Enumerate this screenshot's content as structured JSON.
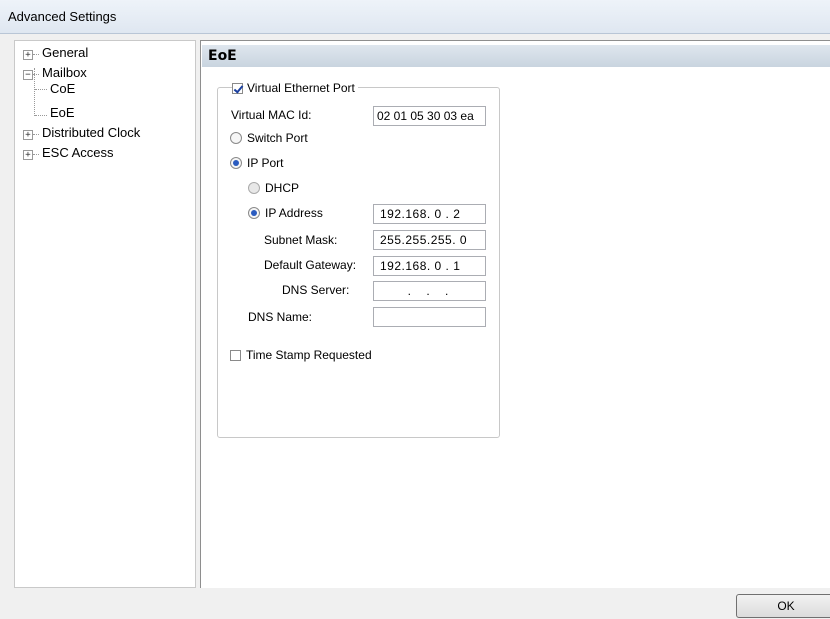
{
  "window": {
    "title": "Advanced Settings"
  },
  "tree": {
    "items": [
      {
        "label": "General",
        "expander": "+"
      },
      {
        "label": "Mailbox",
        "expander": "−"
      },
      {
        "label": "CoE"
      },
      {
        "label": "EoE"
      },
      {
        "label": "Distributed Clock",
        "expander": "+"
      },
      {
        "label": "ESC Access",
        "expander": "+"
      }
    ]
  },
  "panel": {
    "header": "EoE",
    "virtual_ethernet_port": {
      "label": "Virtual Ethernet Port",
      "checked": true
    },
    "mac": {
      "label": "Virtual MAC Id:",
      "value": "02 01 05 30 03 ea"
    },
    "switch_port": {
      "label": "Switch Port",
      "selected": false
    },
    "ip_port": {
      "label": "IP Port",
      "selected": true
    },
    "dhcp": {
      "label": "DHCP",
      "selected": false
    },
    "ip_address": {
      "label": "IP Address",
      "value": "192.168. 0 . 2",
      "selected": true
    },
    "subnet_mask": {
      "label": "Subnet Mask:",
      "value": "255.255.255. 0"
    },
    "default_gateway": {
      "label": "Default Gateway:",
      "value": "192.168. 0 . 1"
    },
    "dns_server": {
      "label": "DNS Server:",
      "value": ". . ."
    },
    "dns_name": {
      "label": "DNS Name:",
      "value": ""
    },
    "time_stamp": {
      "label": "Time Stamp Requested",
      "checked": false
    }
  },
  "buttons": {
    "ok": "OK"
  }
}
